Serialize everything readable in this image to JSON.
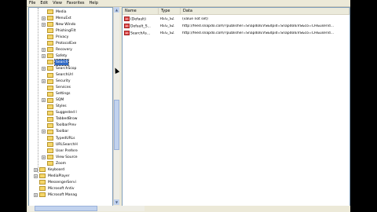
{
  "menu": [
    "File",
    "Edit",
    "View",
    "Favorites",
    "Help"
  ],
  "tree": {
    "items": [
      {
        "label": "Media",
        "expandable": false
      },
      {
        "label": "MenuExt",
        "expandable": true
      },
      {
        "label": "New Windo",
        "expandable": true
      },
      {
        "label": "PhishingFilt",
        "expandable": false
      },
      {
        "label": "Privacy",
        "expandable": false
      },
      {
        "label": "ProtocolExe",
        "expandable": false
      },
      {
        "label": "Recovery",
        "expandable": true
      },
      {
        "label": "Safety",
        "expandable": true
      },
      {
        "label": "Search",
        "expandable": false,
        "selected": true
      },
      {
        "label": "SearchScop",
        "expandable": true
      },
      {
        "label": "SearchUrl",
        "expandable": false
      },
      {
        "label": "Security",
        "expandable": true
      },
      {
        "label": "Services",
        "expandable": false
      },
      {
        "label": "Settings",
        "expandable": false
      },
      {
        "label": "SQM",
        "expandable": true
      },
      {
        "label": "Styles",
        "expandable": false
      },
      {
        "label": "Suggested I",
        "expandable": false
      },
      {
        "label": "TabbedBrow",
        "expandable": false
      },
      {
        "label": "ToolbarPrev",
        "expandable": false
      },
      {
        "label": "Toolbar",
        "expandable": true
      },
      {
        "label": "TypedURLs",
        "expandable": false
      },
      {
        "label": "URLSearchH",
        "expandable": false
      },
      {
        "label": "User Prefere",
        "expandable": false
      },
      {
        "label": "View Source",
        "expandable": true
      },
      {
        "label": "Zoom",
        "expandable": false
      }
    ],
    "root_items": [
      {
        "label": "Keyboard",
        "expandable": true
      },
      {
        "label": "MediaPlayer",
        "expandable": true
      },
      {
        "label": "MessengerServi",
        "expandable": false
      },
      {
        "label": "Microsoft Antiv",
        "expandable": false
      },
      {
        "label": "Microsoft Manag",
        "expandable": true
      }
    ]
  },
  "list": {
    "headers": [
      "Name",
      "Type",
      "Data"
    ],
    "rows": [
      {
        "name": "(Default)",
        "type": "REG_SZ",
        "data": "(value not set)"
      },
      {
        "name": "Default_S...",
        "type": "REG_SZ",
        "data": "http://feed.snapdo.com/?publisher=SnapdoIEVS&dpid=SnapdoIEVS&co=CH&userid..."
      },
      {
        "name": "SearchAs...",
        "type": "REG_SZ",
        "data": "http://feed.snapdo.com/?publisher=SnapdoIEVS&dpid=SnapdoIEVS&co=CH&userid..."
      }
    ]
  },
  "icons": {
    "value": "reg-value-icon",
    "folder": "folder-icon"
  },
  "colors": {
    "selection": "#316ac5",
    "window": "#ece9d8"
  }
}
